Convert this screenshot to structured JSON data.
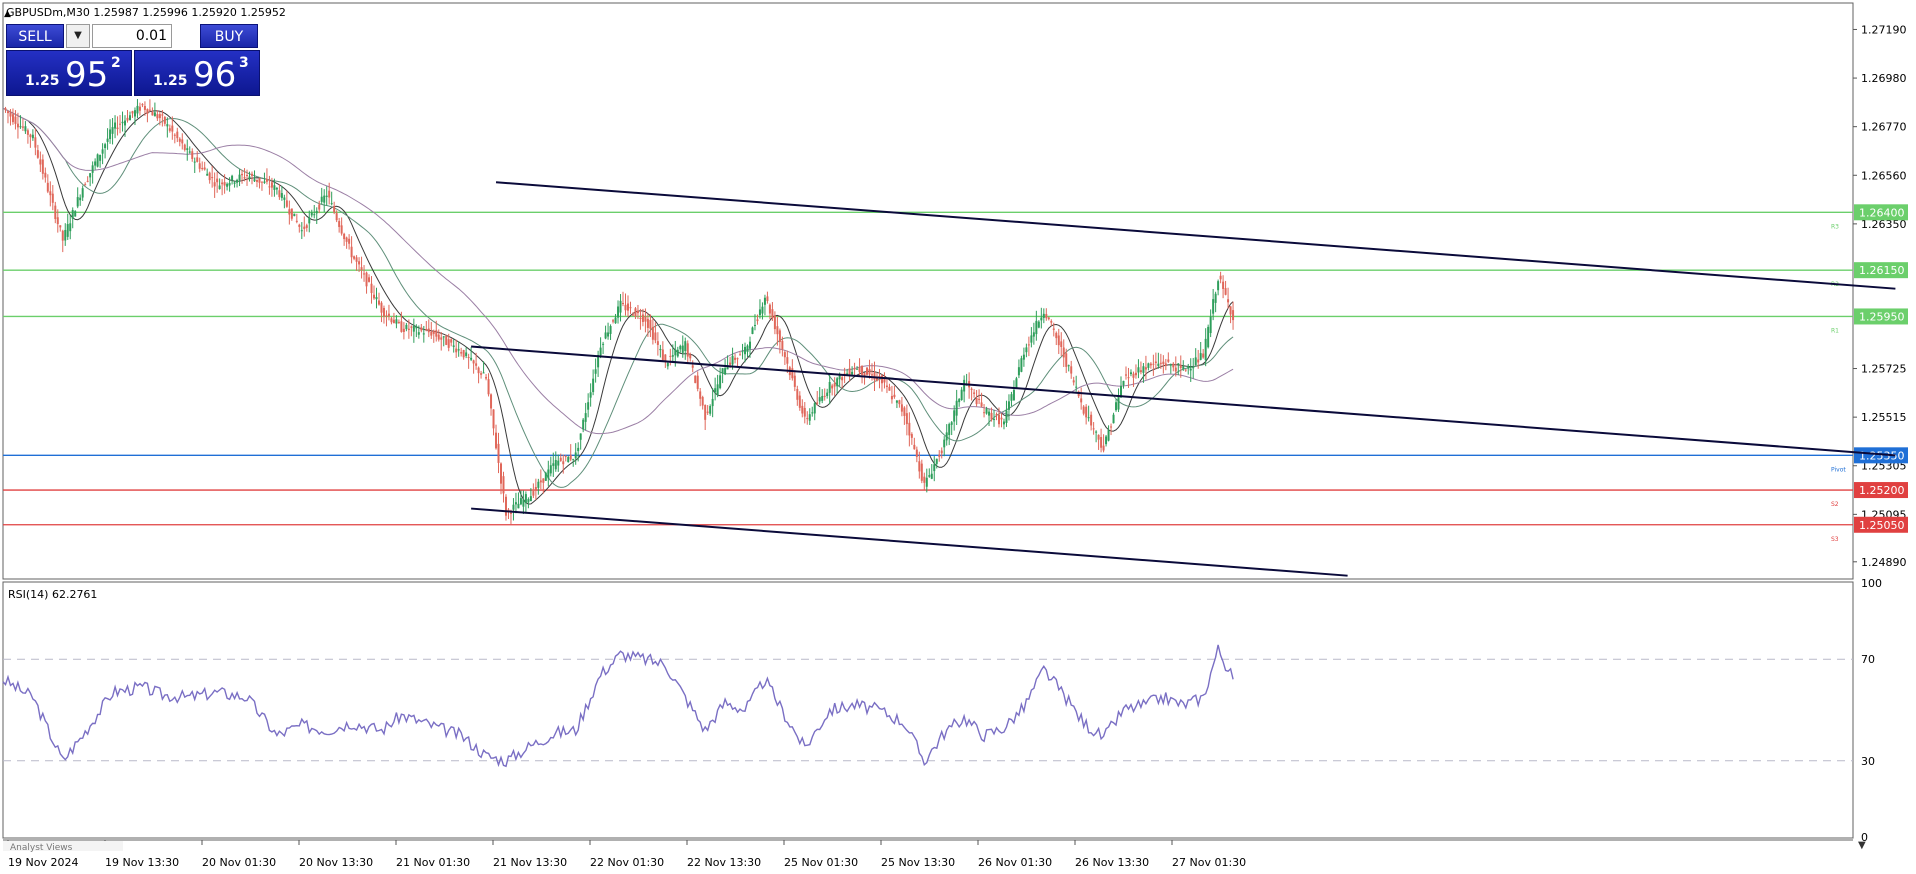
{
  "header": {
    "symbol_info": "GBPUSDm,M30  1.25987 1.25996 1.25920 1.25952"
  },
  "trade_panel": {
    "sell_label": "SELL",
    "buy_label": "BUY",
    "lot_value": "0.01",
    "sell_prefix": "1.25",
    "sell_big": "95",
    "sell_sup": "2",
    "buy_prefix": "1.25",
    "buy_big": "96",
    "buy_sup": "3"
  },
  "chart_data": [
    {
      "type": "candlestick",
      "title": "GBPUSDm,M30",
      "ohlc_last": {
        "open": 1.25987,
        "high": 1.25996,
        "low": 1.2592,
        "close": 1.25952
      },
      "y_ticks": [
        "1.27190",
        "1.26980",
        "1.26770",
        "1.26560",
        "1.26350",
        "1.25725",
        "1.25515",
        "1.25305",
        "1.25095",
        "1.24890"
      ],
      "ylim": [
        1.2482,
        1.273
      ],
      "x_ticks": [
        "19 Nov 2024",
        "19 Nov 13:30",
        "20 Nov 01:30",
        "20 Nov 13:30",
        "21 Nov 01:30",
        "21 Nov 13:30",
        "22 Nov 01:30",
        "22 Nov 13:30",
        "25 Nov 01:30",
        "25 Nov 13:30",
        "26 Nov 01:30",
        "26 Nov 13:30",
        "27 Nov 01:30"
      ],
      "close_path": [
        [
          0,
          1.2685
        ],
        [
          12,
          1.2672
        ],
        [
          24,
          1.2628
        ],
        [
          32,
          1.2651
        ],
        [
          44,
          1.2676
        ],
        [
          56,
          1.2686
        ],
        [
          64,
          1.268
        ],
        [
          74,
          1.2666
        ],
        [
          86,
          1.2652
        ],
        [
          98,
          1.2656
        ],
        [
          110,
          1.265
        ],
        [
          120,
          1.2632
        ],
        [
          130,
          1.2648
        ],
        [
          140,
          1.2622
        ],
        [
          152,
          1.2598
        ],
        [
          160,
          1.259
        ],
        [
          172,
          1.2588
        ],
        [
          184,
          1.258
        ],
        [
          194,
          1.2568
        ],
        [
          202,
          1.251
        ],
        [
          212,
          1.2518
        ],
        [
          222,
          1.2532
        ],
        [
          230,
          1.2535
        ],
        [
          240,
          1.2583
        ],
        [
          248,
          1.26
        ],
        [
          258,
          1.2594
        ],
        [
          266,
          1.2575
        ],
        [
          274,
          1.2583
        ],
        [
          282,
          1.2552
        ],
        [
          290,
          1.2574
        ],
        [
          298,
          1.258
        ],
        [
          306,
          1.2604
        ],
        [
          314,
          1.2578
        ],
        [
          322,
          1.255
        ],
        [
          332,
          1.2565
        ],
        [
          342,
          1.2573
        ],
        [
          352,
          1.2568
        ],
        [
          362,
          1.2553
        ],
        [
          370,
          1.2522
        ],
        [
          378,
          1.254
        ],
        [
          386,
          1.2567
        ],
        [
          394,
          1.2554
        ],
        [
          402,
          1.2549
        ],
        [
          410,
          1.258
        ],
        [
          418,
          1.2598
        ],
        [
          426,
          1.2578
        ],
        [
          434,
          1.2555
        ],
        [
          442,
          1.2538
        ],
        [
          450,
          1.2568
        ],
        [
          458,
          1.2573
        ],
        [
          466,
          1.2575
        ],
        [
          474,
          1.2572
        ],
        [
          482,
          1.2578
        ],
        [
          488,
          1.2612
        ],
        [
          494,
          1.2595
        ]
      ],
      "indicators": [
        {
          "name": "MA fast",
          "color": "#3a3a3a"
        },
        {
          "name": "MA medium",
          "color": "#5f8f7a"
        },
        {
          "name": "MA slow",
          "color": "#9b7fa5"
        }
      ],
      "levels": [
        {
          "value": 1.264,
          "label": "1.26400",
          "tag": "R3",
          "color": "#6bcf6b"
        },
        {
          "value": 1.2615,
          "label": "1.26150",
          "tag": "R2",
          "color": "#6bcf6b"
        },
        {
          "value": 1.2595,
          "label": "1.25950",
          "tag": "R1",
          "color": "#6bcf6b"
        },
        {
          "value": 1.2535,
          "label": "1.25350",
          "tag": "Pivot",
          "color": "#1f6fd6"
        },
        {
          "value": 1.252,
          "label": "1.25200",
          "tag": "S2",
          "color": "#e04040"
        },
        {
          "value": 1.2505,
          "label": "1.25050",
          "tag": "S3",
          "color": "#e04040"
        }
      ],
      "trendlines": [
        {
          "from": [
            198,
            1.2653
          ],
          "to": [
            760,
            1.2607
          ]
        },
        {
          "from": [
            188,
            1.2582
          ],
          "to": [
            760,
            1.2535
          ]
        },
        {
          "from": [
            188,
            1.2512
          ],
          "to": [
            540,
            1.2483
          ]
        }
      ]
    },
    {
      "type": "line",
      "title": "RSI(14) 62.2761",
      "indicator": "RSI(14)",
      "value": 62.2761,
      "ylim": [
        0,
        100
      ],
      "y_ticks": [
        "100",
        "70",
        "30",
        "0"
      ],
      "levels": [
        70,
        30
      ],
      "path": [
        [
          0,
          62
        ],
        [
          12,
          55
        ],
        [
          24,
          30
        ],
        [
          32,
          40
        ],
        [
          44,
          57
        ],
        [
          56,
          59
        ],
        [
          64,
          56
        ],
        [
          74,
          55
        ],
        [
          86,
          57
        ],
        [
          98,
          55
        ],
        [
          110,
          40
        ],
        [
          120,
          44
        ],
        [
          130,
          42
        ],
        [
          140,
          45
        ],
        [
          152,
          42
        ],
        [
          160,
          48
        ],
        [
          172,
          44
        ],
        [
          184,
          40
        ],
        [
          194,
          32
        ],
        [
          202,
          30
        ],
        [
          212,
          36
        ],
        [
          222,
          41
        ],
        [
          230,
          42
        ],
        [
          240,
          64
        ],
        [
          248,
          72
        ],
        [
          258,
          70
        ],
        [
          266,
          68
        ],
        [
          274,
          55
        ],
        [
          282,
          42
        ],
        [
          290,
          53
        ],
        [
          298,
          50
        ],
        [
          306,
          62
        ],
        [
          314,
          48
        ],
        [
          322,
          35
        ],
        [
          332,
          50
        ],
        [
          342,
          52
        ],
        [
          352,
          50
        ],
        [
          362,
          45
        ],
        [
          370,
          30
        ],
        [
          378,
          41
        ],
        [
          386,
          47
        ],
        [
          394,
          40
        ],
        [
          402,
          43
        ],
        [
          410,
          51
        ],
        [
          418,
          66
        ],
        [
          426,
          56
        ],
        [
          434,
          45
        ],
        [
          442,
          39
        ],
        [
          450,
          50
        ],
        [
          458,
          52
        ],
        [
          466,
          55
        ],
        [
          474,
          52
        ],
        [
          482,
          55
        ],
        [
          488,
          74
        ],
        [
          494,
          62
        ]
      ],
      "line_color": "#7a6fc4"
    }
  ],
  "bottom_bar": {
    "label": "Analyst Views"
  }
}
